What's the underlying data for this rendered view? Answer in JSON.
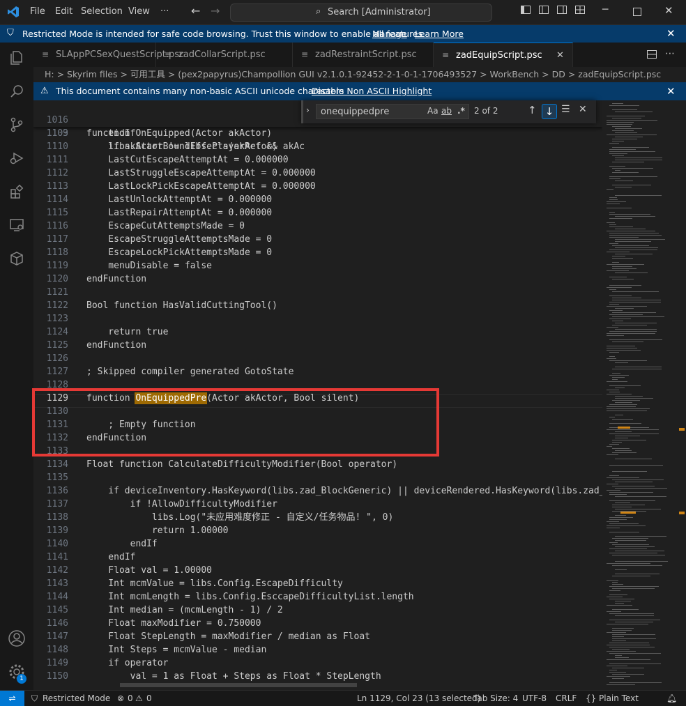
{
  "titlebar": {
    "menus": [
      "File",
      "Edit",
      "Selection",
      "View",
      "···"
    ],
    "search_text": "Search [Administrator]"
  },
  "banner": {
    "message": "Restricted Mode is intended for safe code browsing. Trust this window to enable all features.",
    "manage": "Manage",
    "learn_more": "Learn More"
  },
  "tabs": [
    {
      "label": "SLAppPCSexQuestScript.psc"
    },
    {
      "label": "zadCollarScript.psc"
    },
    {
      "label": "zadRestraintScript.psc"
    },
    {
      "label": "zadEquipScript.psc"
    }
  ],
  "breadcrumb": "H: > Skyrim files > 可用工具 > (pex2papyrus)Champollion GUI v2.1.0.1-92452-2-1-0-1-1706493527 > WorkBench > DD > zadEquipScript.psc",
  "notice": {
    "message": "This document contains many non-basic ASCII unicode characters",
    "action": "Disable Non ASCII Highlight"
  },
  "find": {
    "query": "onequippedpre",
    "match_case": "Aa",
    "whole_word": "ab",
    "regex": ".*",
    "count": "2 of 2"
  },
  "editor": {
    "sticky": [
      {
        "n": "1016",
        "t": "function OnEquipped(Actor akActor)"
      },
      {
        "n": "1103",
        "t": "    if akActor != libs.PlayerRef && akAc"
      }
    ],
    "lines": [
      {
        "n": "1109",
        "t": "    endIf"
      },
      {
        "n": "1110",
        "t": "    libs.StartBoundEffects(akActor)"
      },
      {
        "n": "1111",
        "t": "    LastCutEscapeAttemptAt = 0.000000"
      },
      {
        "n": "1112",
        "t": "    LastStruggleEscapeAttemptAt = 0.000000"
      },
      {
        "n": "1113",
        "t": "    LastLockPickEscapeAttemptAt = 0.000000"
      },
      {
        "n": "1114",
        "t": "    LastUnlockAttemptAt = 0.000000"
      },
      {
        "n": "1115",
        "t": "    LastRepairAttemptAt = 0.000000"
      },
      {
        "n": "1116",
        "t": "    EscapeCutAttemptsMade = 0"
      },
      {
        "n": "1117",
        "t": "    EscapeStruggleAttemptsMade = 0"
      },
      {
        "n": "1118",
        "t": "    EscapeLockPickAttemptsMade = 0"
      },
      {
        "n": "1119",
        "t": "    menuDisable = false"
      },
      {
        "n": "1120",
        "t": "endFunction"
      },
      {
        "n": "1121",
        "t": ""
      },
      {
        "n": "1122",
        "t": "Bool function HasValidCuttingTool()"
      },
      {
        "n": "1123",
        "t": ""
      },
      {
        "n": "1124",
        "t": "    return true"
      },
      {
        "n": "1125",
        "t": "endFunction"
      },
      {
        "n": "1126",
        "t": ""
      },
      {
        "n": "1127",
        "t": "; Skipped compiler generated GotoState"
      },
      {
        "n": "1128",
        "t": ""
      },
      {
        "n": "1129",
        "t": "function ",
        "m": "OnEquippedPre",
        "r": "(Actor akActor, Bool silent)"
      },
      {
        "n": "1130",
        "t": ""
      },
      {
        "n": "1131",
        "t": "    ; Empty function"
      },
      {
        "n": "1132",
        "t": "endFunction"
      },
      {
        "n": "1133",
        "t": ""
      },
      {
        "n": "1134",
        "t": "Float function CalculateDifficultyModifier(Bool operator)"
      },
      {
        "n": "1135",
        "t": ""
      },
      {
        "n": "1136",
        "t": "    if deviceInventory.HasKeyword(libs.zad_BlockGeneric) || deviceRendered.HasKeyword(libs.zad_B"
      },
      {
        "n": "1137",
        "t": "        if !AllowDifficultyModifier"
      },
      {
        "n": "1138",
        "t": "            libs.Log(\"未应用难度修正 - 自定义/任务物品! \", 0)"
      },
      {
        "n": "1139",
        "t": "            return 1.00000"
      },
      {
        "n": "1140",
        "t": "        endIf"
      },
      {
        "n": "1141",
        "t": "    endIf"
      },
      {
        "n": "1142",
        "t": "    Float val = 1.00000"
      },
      {
        "n": "1143",
        "t": "    Int mcmValue = libs.Config.EscapeDifficulty"
      },
      {
        "n": "1144",
        "t": "    Int mcmLength = libs.Config.EsccapeDifficultyList.length"
      },
      {
        "n": "1145",
        "t": "    Int median = (mcmLength - 1) / 2"
      },
      {
        "n": "1146",
        "t": "    Float maxModifier = 0.750000"
      },
      {
        "n": "1147",
        "t": "    Float StepLength = maxModifier / median as Float"
      },
      {
        "n": "1148",
        "t": "    Int Steps = mcmValue - median"
      },
      {
        "n": "1149",
        "t": "    if operator"
      },
      {
        "n": "1150",
        "t": "        val = 1 as Float + Steps as Float * StepLength"
      }
    ]
  },
  "statusbar": {
    "restricted": "Restricted Mode",
    "errors": "0",
    "warnings": "0",
    "position": "Ln 1129, Col 23 (13 selected)",
    "tab_size": "Tab Size: 4",
    "encoding": "UTF-8",
    "eol": "CRLF",
    "language": "Plain Text"
  },
  "accounts_badge": "1"
}
